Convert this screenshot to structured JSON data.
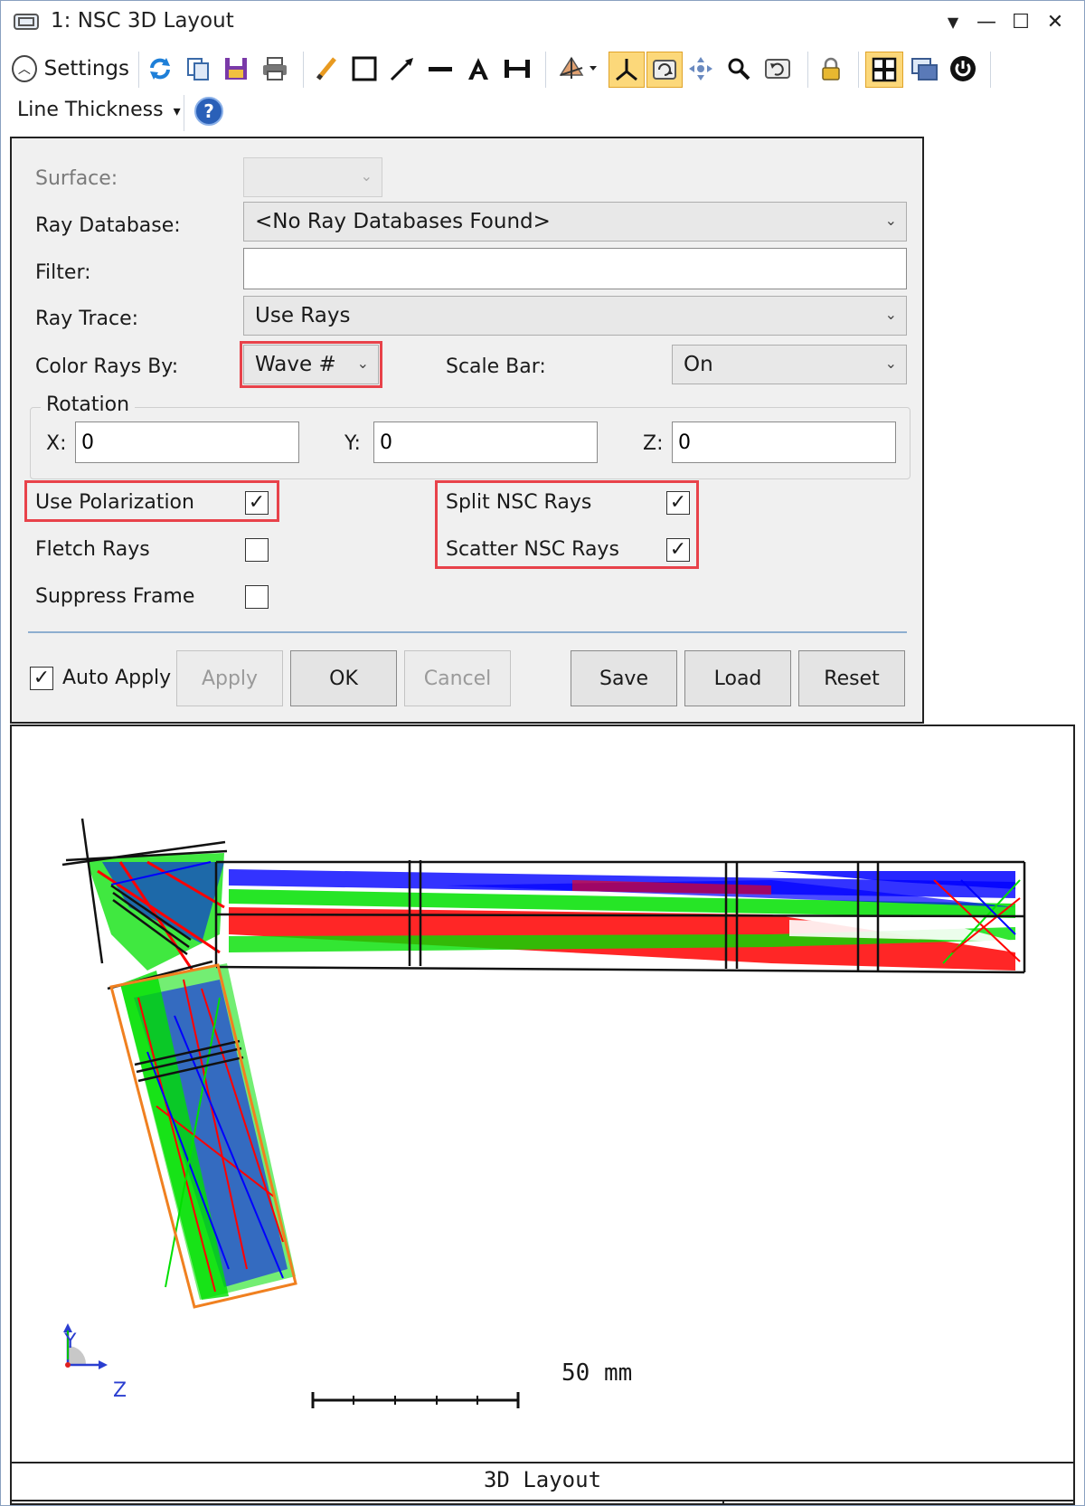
{
  "window": {
    "title": "1: NSC 3D Layout",
    "buttons": [
      "▼",
      "—",
      "☐",
      "✕"
    ]
  },
  "toolbar": {
    "settings_label": "Settings",
    "line_thickness_label": "Line Thickness",
    "line_thickness_arrow": "▾",
    "help_glyph": "?"
  },
  "settings": {
    "surface_label": "Surface:",
    "surface_value": "",
    "ray_database_label": "Ray Database:",
    "ray_database_value": "<No Ray Databases Found>",
    "filter_label": "Filter:",
    "filter_value": "",
    "ray_trace_label": "Ray Trace:",
    "ray_trace_value": "Use Rays",
    "color_rays_label": "Color Rays By:",
    "color_rays_value": "Wave #",
    "scale_bar_label": "Scale Bar:",
    "scale_bar_value": "On",
    "rotation_label": "Rotation",
    "rot_x_label": "X:",
    "rot_x_value": "0",
    "rot_y_label": "Y:",
    "rot_y_value": "0",
    "rot_z_label": "Z:",
    "rot_z_value": "0",
    "use_polarization_label": "Use Polarization",
    "use_polarization_checked": true,
    "fletch_rays_label": "Fletch Rays",
    "fletch_rays_checked": false,
    "suppress_frame_label": "Suppress Frame",
    "suppress_frame_checked": false,
    "split_nsc_label": "Split NSC Rays",
    "split_nsc_checked": true,
    "scatter_nsc_label": "Scatter NSC Rays",
    "scatter_nsc_checked": true,
    "auto_apply_label": "Auto Apply",
    "auto_apply_checked": true,
    "check_glyph": "✓"
  },
  "buttons": {
    "apply": "Apply",
    "ok": "OK",
    "cancel": "Cancel",
    "save": "Save",
    "load": "Load",
    "reset": "Reset"
  },
  "layout": {
    "scale_bar_label": "50 mm",
    "axis_y_label": "Y",
    "axis_z_label": "Z",
    "footer_title": "3D Layout"
  },
  "colors": {
    "highlight": "#e8424a",
    "ray_red": "#ff0000",
    "ray_green": "#00e000",
    "ray_blue": "#0000ff",
    "detector_orange": "#f08020",
    "toggle_active": "#fcd87a"
  }
}
